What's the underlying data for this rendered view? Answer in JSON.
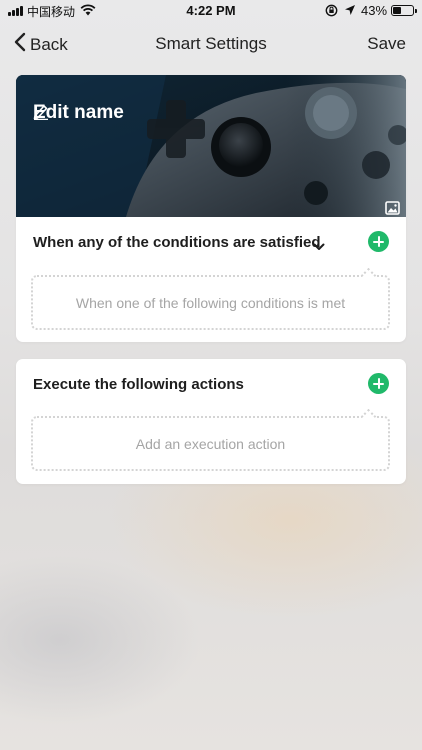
{
  "status_bar": {
    "carrier": "中国移动",
    "time": "4:22 PM",
    "battery_percent_label": "43%",
    "battery_level": 0.43
  },
  "nav": {
    "back_label": "Back",
    "title": "Smart Settings",
    "save_label": "Save"
  },
  "scene": {
    "edit_name_label": "Edit name",
    "conditions": {
      "title": "When any of the conditions are satisfied",
      "placeholder": "When one of the following conditions is met"
    },
    "actions": {
      "title": "Execute the following actions",
      "placeholder": "Add an execution action"
    }
  },
  "colors": {
    "accent_green": "#20b96a",
    "placeholder_text": "#a5a5a5",
    "dotted_border": "#d4d4d4"
  },
  "icons": {
    "back": "chevron-left-icon",
    "edit": "pencil-icon",
    "image": "image-icon",
    "dropdown": "chevron-down-icon",
    "add": "plus-circle-icon"
  }
}
